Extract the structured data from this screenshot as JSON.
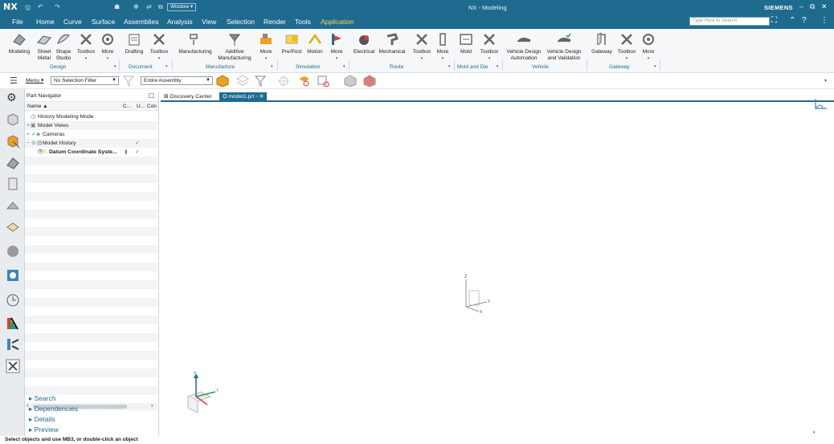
{
  "titlebar": {
    "app_logo": "NX",
    "window_menu": "Window",
    "title": "NX - Modeling",
    "brand": "SIEMENS"
  },
  "menu": {
    "items": [
      "File",
      "Home",
      "Curve",
      "Surface",
      "Assemblies",
      "Analysis",
      "View",
      "Selection",
      "Render",
      "Tools",
      "Application"
    ],
    "active": "Application",
    "search_placeholder": "Type Here to Search"
  },
  "ribbon": {
    "buttons": [
      {
        "label": "Modeling",
        "label2": "",
        "icon": "modeling-icon"
      },
      {
        "label": "Sheet",
        "label2": "Metal",
        "icon": "sheet-metal-icon"
      },
      {
        "label": "Shape",
        "label2": "Studio",
        "icon": "shape-studio-icon"
      },
      {
        "label": "Toolbox",
        "label2": "",
        "icon": "toolbox-icon"
      },
      {
        "label": "More",
        "label2": "",
        "icon": "more-icon"
      },
      {
        "label": "Drafting",
        "label2": "",
        "icon": "drafting-icon"
      },
      {
        "label": "Toolbox",
        "label2": "",
        "icon": "toolbox-icon"
      },
      {
        "label": "Manufacturing",
        "label2": "",
        "icon": "manufacturing-icon"
      },
      {
        "label": "Additive",
        "label2": "Manufacturing",
        "icon": "additive-manufacturing-icon"
      },
      {
        "label": "More",
        "label2": "",
        "icon": "more-icon"
      },
      {
        "label": "Pre/Post",
        "label2": "",
        "icon": "pre-post-icon"
      },
      {
        "label": "Motion",
        "label2": "",
        "icon": "motion-icon"
      },
      {
        "label": "More",
        "label2": "",
        "icon": "more-icon"
      },
      {
        "label": "Electrical",
        "label2": "",
        "icon": "electrical-icon"
      },
      {
        "label": "Mechanical",
        "label2": "",
        "icon": "mechanical-icon"
      },
      {
        "label": "Toolbox",
        "label2": "",
        "icon": "toolbox-icon"
      },
      {
        "label": "More",
        "label2": "",
        "icon": "more-icon"
      },
      {
        "label": "Mold",
        "label2": "",
        "icon": "mold-icon"
      },
      {
        "label": "Toolbox",
        "label2": "",
        "icon": "toolbox-icon"
      },
      {
        "label": "Vehicle Design",
        "label2": "Automation",
        "icon": "vehicle-design-automation-icon"
      },
      {
        "label": "Vehicle Design",
        "label2": "and Validation",
        "icon": "vehicle-design-validation-icon"
      },
      {
        "label": "Gateway",
        "label2": "",
        "icon": "gateway-icon"
      },
      {
        "label": "Toolbox",
        "label2": "",
        "icon": "toolbox-icon"
      },
      {
        "label": "More",
        "label2": "",
        "icon": "more-icon"
      }
    ],
    "groups": [
      "Design",
      "Document",
      "Manufacture",
      "Simulation",
      "Route",
      "Mold and Die",
      "Vehicle",
      "Gateway"
    ]
  },
  "toolbar": {
    "menu_label": "Menu",
    "selection_filter": "No Selection Filter",
    "assembly_scope": "Entire Assembly"
  },
  "navigator": {
    "title": "Part Navigator",
    "columns": [
      "Name",
      "C...",
      "U...",
      "Con"
    ],
    "rows": [
      {
        "label": "History Modeling Mode",
        "mark": "",
        "bold": false
      },
      {
        "label": "Model Views",
        "mark": "",
        "bold": false
      },
      {
        "label": "Cameras",
        "mark": "",
        "bold": false
      },
      {
        "label": "Model History",
        "mark": "✓",
        "bold": false
      },
      {
        "label": "Datum Coordinate Syste...",
        "mark": "✓",
        "bold": true
      }
    ],
    "sections": [
      "Search",
      "Dependencies",
      "Details",
      "Preview"
    ]
  },
  "tabs": [
    {
      "label": "Discovery Center",
      "active": false
    },
    {
      "label": "model1.prt",
      "active": true
    }
  ],
  "status": "Select objects and use MB3, or double-click an object",
  "colors": {
    "accent": "#1e6b8f",
    "active_menu": "#ffd54a"
  }
}
